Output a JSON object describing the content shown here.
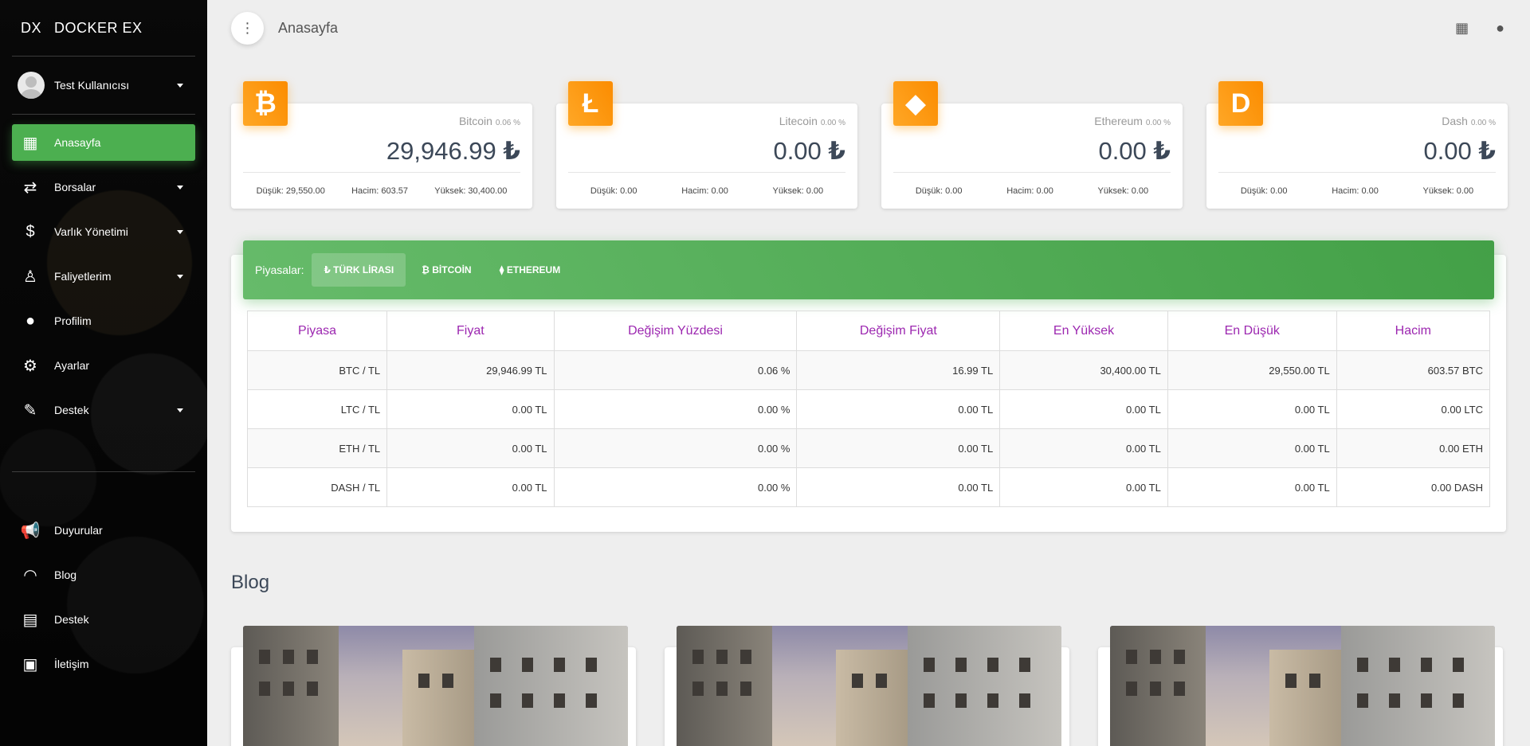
{
  "app": {
    "logo_mini": "DX",
    "logo_text": "DOCKER EX"
  },
  "user": {
    "name": "Test Kullanıcısı"
  },
  "sidebar": {
    "items": [
      {
        "label": "Anasayfa",
        "icon": "dashboard-icon",
        "glyph": "▦",
        "active": true,
        "caret": false
      },
      {
        "label": "Borsalar",
        "icon": "exchange-icon",
        "glyph": "⇄",
        "caret": true
      },
      {
        "label": "Varlık Yönetimi",
        "icon": "dollar-icon",
        "glyph": "$",
        "caret": true
      },
      {
        "label": "Faliyetlerim",
        "icon": "accessibility-icon",
        "glyph": "♙",
        "caret": true
      },
      {
        "label": "Profilim",
        "icon": "person-icon",
        "glyph": "●",
        "caret": false
      },
      {
        "label": "Ayarlar",
        "icon": "gear-icon",
        "glyph": "⚙",
        "caret": false
      },
      {
        "label": "Destek",
        "icon": "ticket-icon",
        "glyph": "✎",
        "caret": true
      }
    ],
    "items2": [
      {
        "label": "Duyurular",
        "icon": "megaphone-icon",
        "glyph": "📢"
      },
      {
        "label": "Blog",
        "icon": "rss-icon",
        "glyph": "◠"
      },
      {
        "label": "Destek",
        "icon": "document-icon",
        "glyph": "▤"
      },
      {
        "label": "İletişim",
        "icon": "contact-card-icon",
        "glyph": "▣"
      }
    ]
  },
  "topbar": {
    "title": "Anasayfa"
  },
  "stats": [
    {
      "name": "Bitcoin",
      "change": "0.06 %",
      "value": "29,946.99",
      "currency": "₺",
      "icon": "bitcoin-icon",
      "glyph": "₿",
      "low": "Düşük: 29,550.00",
      "volume": "Hacim: 603.57",
      "high": "Yüksek: 30,400.00"
    },
    {
      "name": "Litecoin",
      "change": "0.00 %",
      "value": "0.00",
      "currency": "₺",
      "icon": "litecoin-icon",
      "glyph": "Ł",
      "low": "Düşük: 0.00",
      "volume": "Hacim: 0.00",
      "high": "Yüksek: 0.00"
    },
    {
      "name": "Ethereum",
      "change": "0.00 %",
      "value": "0.00",
      "currency": "₺",
      "icon": "ethereum-icon",
      "glyph": "◆",
      "low": "Düşük: 0.00",
      "volume": "Hacim: 0.00",
      "high": "Yüksek: 0.00"
    },
    {
      "name": "Dash",
      "change": "0.00 %",
      "value": "0.00",
      "currency": "₺",
      "icon": "dash-icon",
      "glyph": "D",
      "low": "Düşük: 0.00",
      "volume": "Hacim: 0.00",
      "high": "Yüksek: 0.00"
    }
  ],
  "markets": {
    "label": "Piyasalar:",
    "tabs": [
      {
        "label": "₺ TÜRK LİRASI",
        "active": true
      },
      {
        "label": "₿ BİTCOİN",
        "active": false
      },
      {
        "label": "⧫ ETHEREUM",
        "active": false
      }
    ],
    "columns": [
      "Piyasa",
      "Fiyat",
      "Değişim Yüzdesi",
      "Değişim Fiyat",
      "En Yüksek",
      "En Düşük",
      "Hacim"
    ],
    "rows": [
      [
        "BTC / TL",
        "29,946.99 TL",
        "0.06 %",
        "16.99 TL",
        "30,400.00 TL",
        "29,550.00 TL",
        "603.57 BTC"
      ],
      [
        "LTC / TL",
        "0.00 TL",
        "0.00 %",
        "0.00 TL",
        "0.00 TL",
        "0.00 TL",
        "0.00 LTC"
      ],
      [
        "ETH / TL",
        "0.00 TL",
        "0.00 %",
        "0.00 TL",
        "0.00 TL",
        "0.00 TL",
        "0.00 ETH"
      ],
      [
        "DASH / TL",
        "0.00 TL",
        "0.00 %",
        "0.00 TL",
        "0.00 TL",
        "0.00 TL",
        "0.00 DASH"
      ]
    ]
  },
  "blog": {
    "title": "Blog",
    "posts": 3
  },
  "colors": {
    "accent": "#4caf50",
    "warning": "#ff9800",
    "table_header": "#9c27b0",
    "sidebar_bg": "#0d0d0d"
  }
}
